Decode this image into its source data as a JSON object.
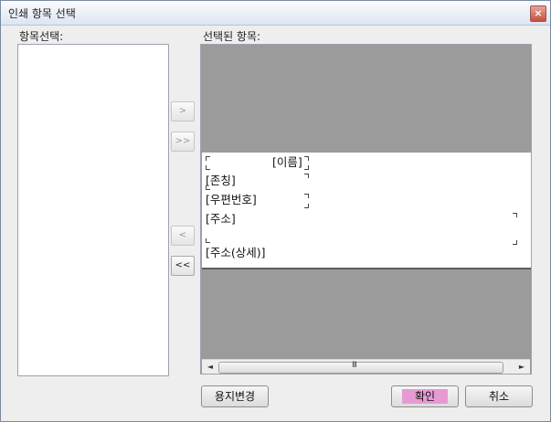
{
  "window": {
    "title": "인쇄 항목 선택",
    "close_symbol": "×"
  },
  "left_panel": {
    "label": "항목선택:",
    "items": []
  },
  "right_panel": {
    "label": "선택된 항목:"
  },
  "transfer_buttons": {
    "add": ">",
    "add_all": ">>",
    "remove": "<",
    "remove_all": "<<"
  },
  "preview_fields": {
    "name": "[이름]",
    "title": "[존칭]",
    "zip": "[우편번호]",
    "address": "[주소]",
    "address_detail": "[주소(상세)]"
  },
  "scrollbar": {
    "left": "◄",
    "right": "►",
    "grip": "III"
  },
  "buttons": {
    "change_paper": "용지변경",
    "ok": "확인",
    "cancel": "취소"
  },
  "colors": {
    "ok_highlight": "#e79ad2",
    "preview_bg": "#9b9b9b"
  }
}
